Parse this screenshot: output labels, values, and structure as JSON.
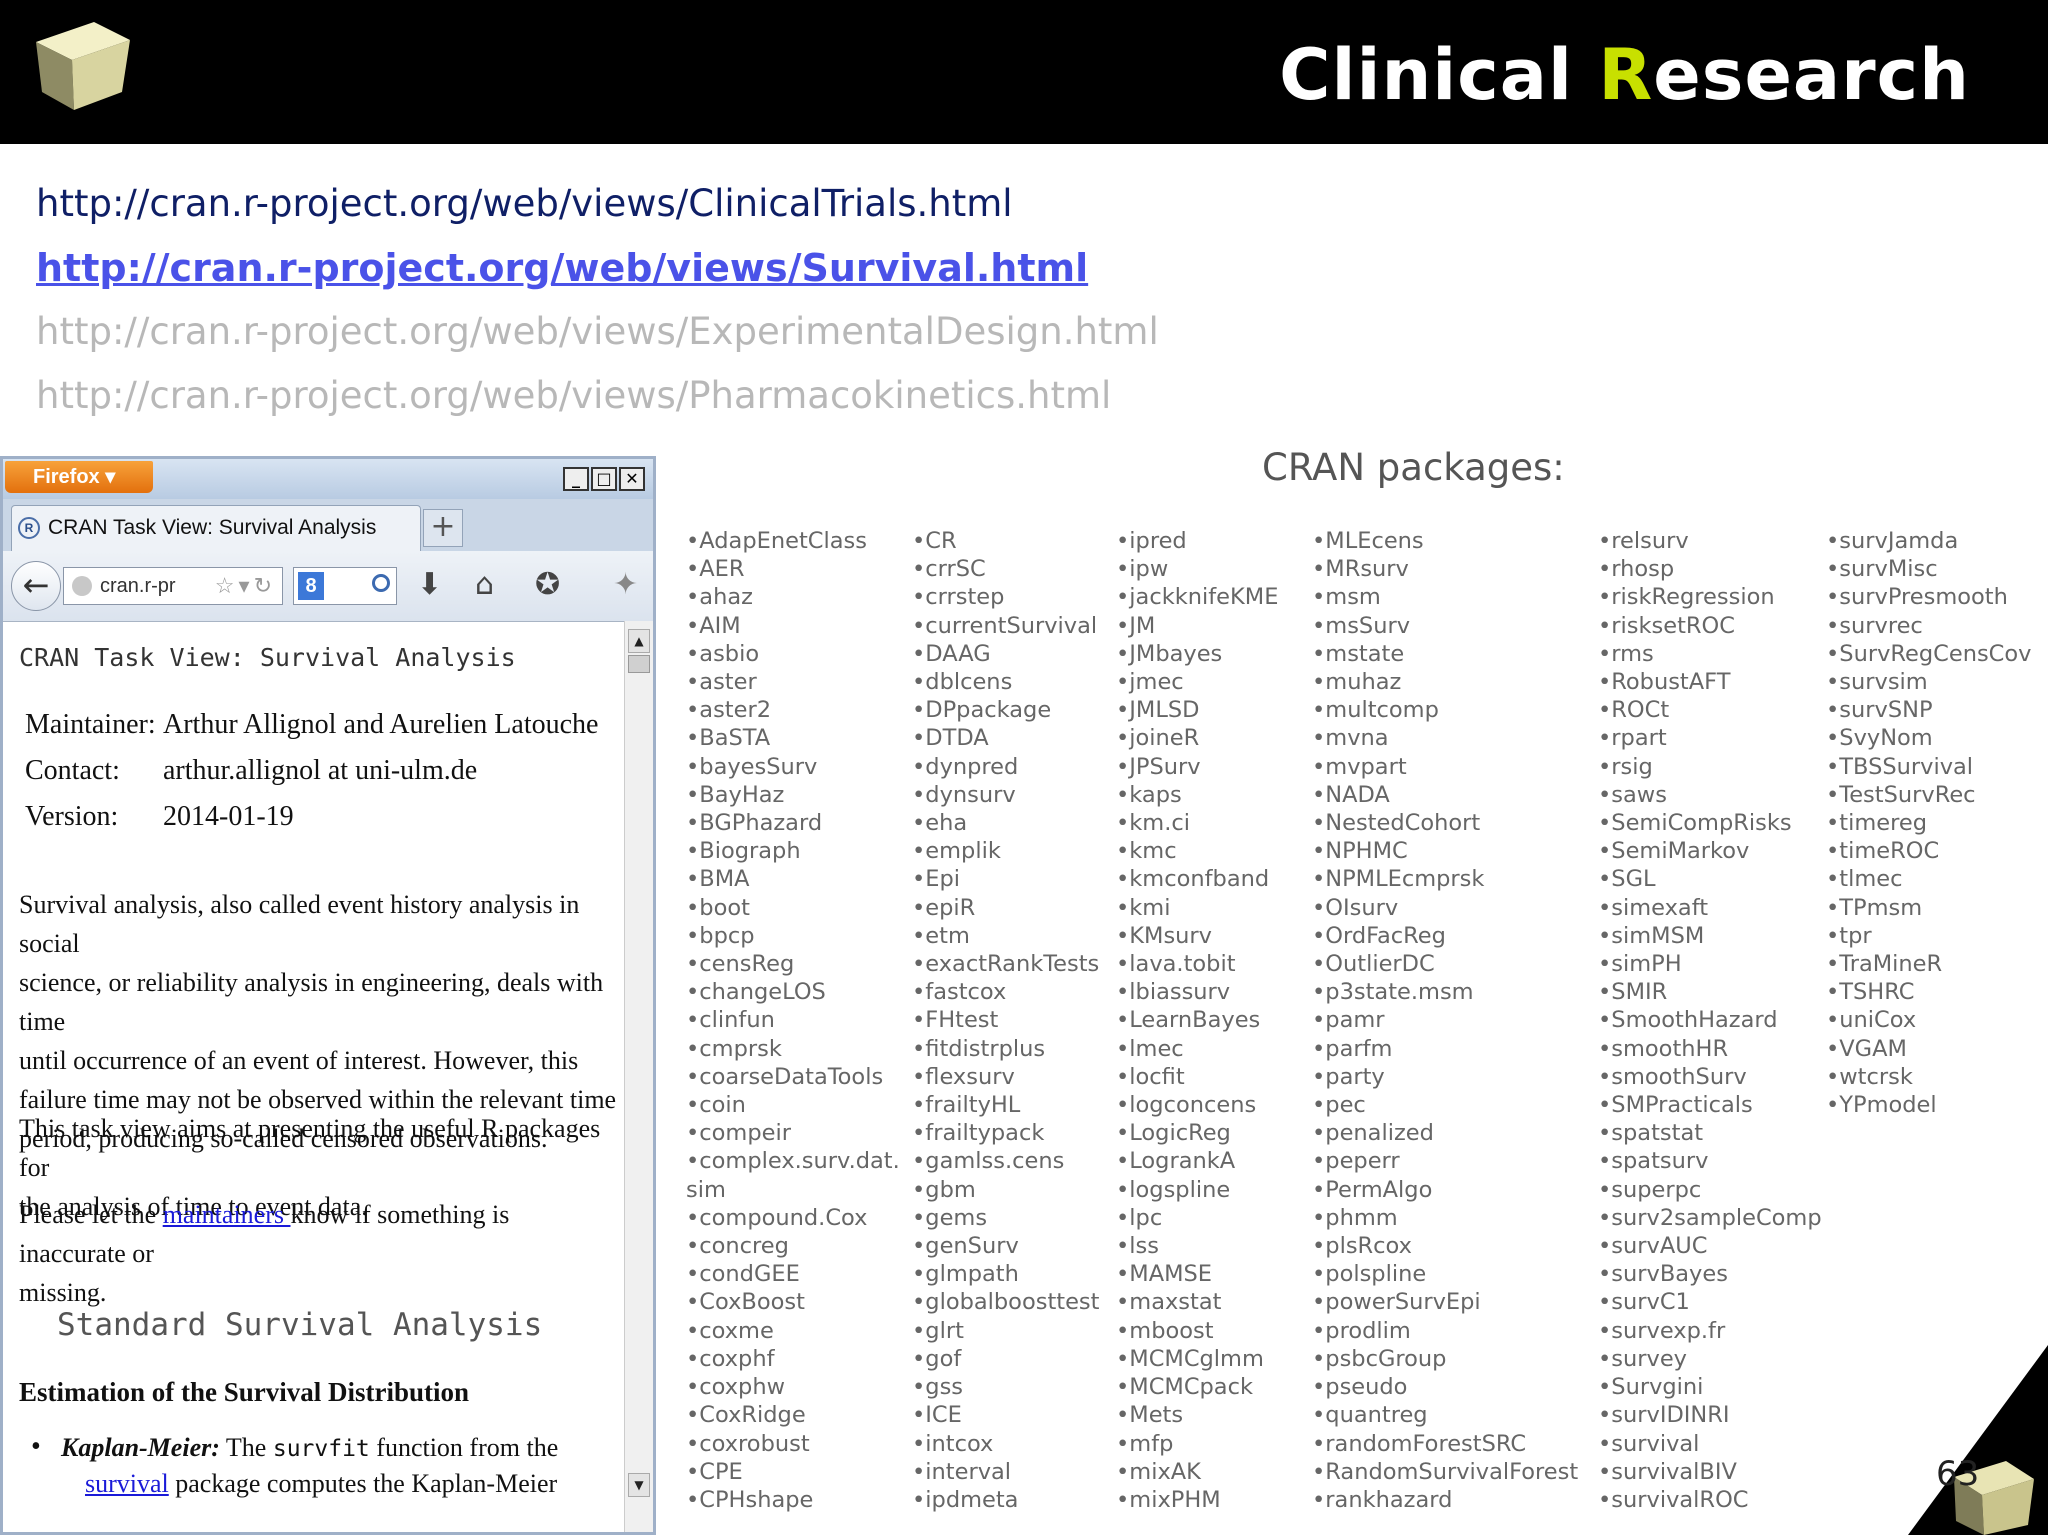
{
  "header": {
    "title_prefix": "Clinical ",
    "title_accent": "R",
    "title_suffix": "esearch"
  },
  "links": [
    "http://cran.r-project.org/web/views/ClinicalTrials.html",
    "http://cran.r-project.org/web/views/Survival.html",
    "http://cran.r-project.org/web/views/ExperimentalDesign.html",
    "http://cran.r-project.org/web/views/Pharmacokinetics.html"
  ],
  "browser": {
    "app_button": "Firefox",
    "tab_title": "CRAN Task View: Survival Analysis",
    "url": "cran.r-pr",
    "search_engine": "8",
    "page": {
      "title": "CRAN Task View: Survival Analysis",
      "maintainer_key": "Maintainer:",
      "maintainer_value": "Arthur Allignol and Aurelien Latouche",
      "contact_key": "Contact:",
      "contact_value": "arthur.allignol at uni-ulm.de",
      "version_key": "Version:",
      "version_value": "2014-01-19",
      "para1_lines": [
        "Survival analysis, also called event history analysis in social",
        "science, or reliability analysis in engineering, deals with time",
        "until occurrence of an event of interest. However, this",
        "failure time may not be observed within the relevant time",
        "period, producing so-called censored observations."
      ],
      "para2_lines": [
        "This task view aims at presenting the useful R packages for",
        "the analysis of time to event data."
      ],
      "para3_before": "Please let the ",
      "para3_link": "maintainers ",
      "para3_after": "know if something is inaccurate or",
      "para3_line2": "missing.",
      "section_heading": "Standard Survival Analysis",
      "subsection_heading": "Estimation of the Survival Distribution",
      "km_bold": "Kaplan-Meier:",
      "km_text1": " The ",
      "km_code": "survfit",
      "km_text2": " function from the",
      "km_next_link": "survival",
      "km_next_text": " package computes the Kaplan-Meier"
    }
  },
  "packages": {
    "heading": "CRAN packages:",
    "columns": [
      [
        "AdapEnetClass",
        "AER",
        "ahaz",
        "AIM",
        "asbio",
        "aster",
        "aster2",
        "BaSTA",
        "bayesSurv",
        "BayHaz",
        "BGPhazard",
        "Biograph",
        "BMA",
        "boot",
        "bpcp",
        "censReg",
        "changeLOS",
        "clinfun",
        "cmprsk",
        "coarseDataTools",
        "coin",
        "compeir",
        "complex.surv.dat.",
        "sim",
        "compound.Cox",
        "concreg",
        "condGEE",
        "CoxBoost",
        "coxme",
        "coxphf",
        "coxphw",
        "CoxRidge",
        "coxrobust",
        "CPE",
        "CPHshape"
      ],
      [
        "CR",
        "crrSC",
        "crrstep",
        "currentSurvival",
        "DAAG",
        "dblcens",
        "DPpackage",
        "DTDA",
        "dynpred",
        "dynsurv",
        "eha",
        "emplik",
        "Epi",
        "epiR",
        "etm",
        "exactRankTests",
        "fastcox",
        "FHtest",
        "fitdistrplus",
        "flexsurv",
        "frailtyHL",
        "frailtypack",
        "gamlss.cens",
        "gbm",
        "gems",
        "genSurv",
        "glmpath",
        "globalboosttest",
        "glrt",
        "gof",
        "gss",
        "ICE",
        "intcox",
        "interval",
        "ipdmeta"
      ],
      [
        "ipred",
        "ipw",
        "jackknifeKME",
        "JM",
        "JMbayes",
        "jmec",
        "JMLSD",
        "joineR",
        "JPSurv",
        "kaps",
        "km.ci",
        "kmc",
        "kmconfband",
        "kmi",
        "KMsurv",
        "lava.tobit",
        "lbiassurv",
        "LearnBayes",
        "lmec",
        "locfit",
        "logconcens",
        "LogicReg",
        "LogrankA",
        "logspline",
        "lpc",
        "lss",
        "MAMSE",
        "maxstat",
        "mboost",
        "MCMCglmm",
        "MCMCpack",
        "Mets",
        "mfp",
        "mixAK",
        "mixPHM"
      ],
      [
        "MLEcens",
        "MRsurv",
        "msm",
        "msSurv",
        "mstate",
        "muhaz",
        "multcomp",
        "mvna",
        "mvpart",
        "NADA",
        "NestedCohort",
        "NPHMC",
        "NPMLEcmprsk",
        "OIsurv",
        "OrdFacReg",
        "OutlierDC",
        "p3state.msm",
        "pamr",
        "parfm",
        "party",
        "pec",
        "penalized",
        "peperr",
        "PermAlgo",
        "phmm",
        "plsRcox",
        "polspline",
        "powerSurvEpi",
        "prodlim",
        "psbcGroup",
        "pseudo",
        "quantreg",
        "randomForestSRC",
        "RandomSurvivalForest",
        "rankhazard"
      ],
      [
        "relsurv",
        "rhosp",
        "riskRegression",
        "risksetROC",
        "rms",
        "RobustAFT",
        "ROCt",
        "rpart",
        "rsig",
        "saws",
        "SemiCompRisks",
        "SemiMarkov",
        "SGL",
        "simexaft",
        "simMSM",
        "simPH",
        "SMIR",
        "SmoothHazard",
        "smoothHR",
        "smoothSurv",
        "SMPracticals",
        "spatstat",
        "spatsurv",
        "superpc",
        "surv2sampleComp",
        "survAUC",
        "survBayes",
        "survC1",
        "survexp.fr",
        "survey",
        "Survgini",
        "survIDINRI",
        "survival",
        "survivalBIV",
        "survivalROC"
      ],
      [
        "survJamda",
        "survMisc",
        "survPresmooth",
        "survrec",
        "SurvRegCensCov",
        "survsim",
        "survSNP",
        "SvyNom",
        "TBSSurvival",
        "TestSurvRec",
        "timereg",
        "timeROC",
        "tlmec",
        "TPmsm",
        "tpr",
        "TraMineR",
        "TSHRC",
        "uniCox",
        "VGAM",
        "wtcrsk",
        "YPmodel"
      ]
    ]
  },
  "page_number": "63",
  "colors": {
    "header_bg": "#000000",
    "title_accent": "#c8e000",
    "link_active": "#4a52e8",
    "link_dark": "#0f1f66",
    "link_faded": "#b8b8b8",
    "package_text": "#666666"
  }
}
